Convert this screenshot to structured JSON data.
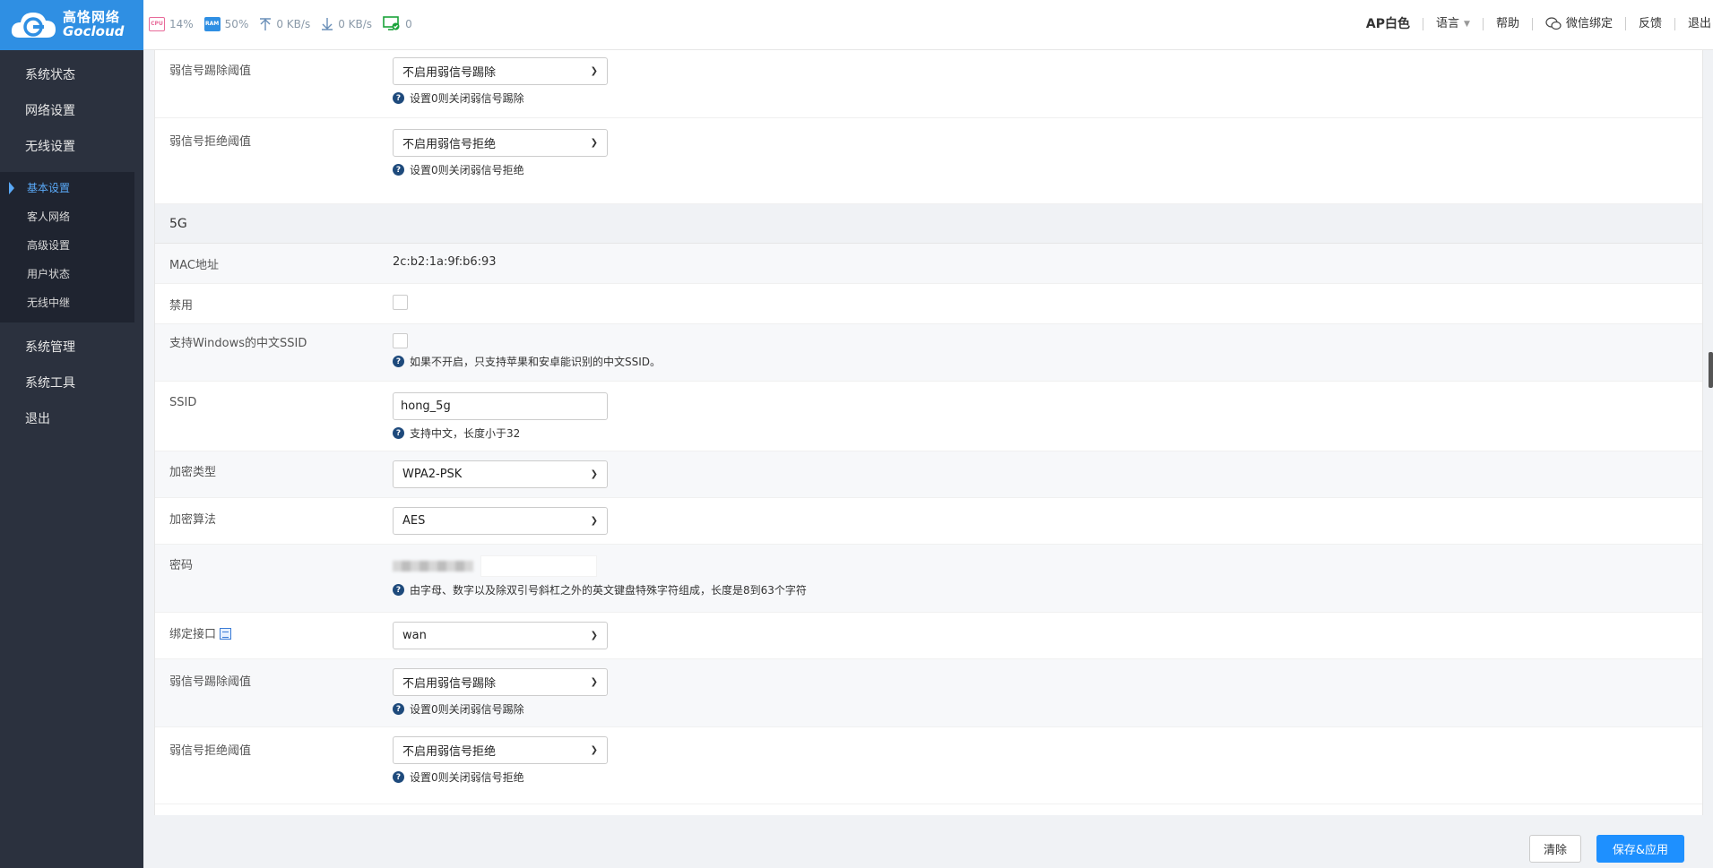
{
  "brand": {
    "cn": "高恪网络",
    "en": "Gocloud"
  },
  "stats": {
    "cpu_label": "CPU",
    "cpu": "14%",
    "ram_label": "RAM",
    "ram": "50%",
    "upload": "0 KB/s",
    "download": "0 KB/s",
    "devices": "0"
  },
  "topnav": {
    "ap": "AP白色",
    "language": "语言",
    "help": "帮助",
    "wechat": "微信绑定",
    "feedback": "反馈",
    "logout": "退出"
  },
  "sidebar": {
    "items": [
      "系统状态",
      "网络设置",
      "无线设置"
    ],
    "sub_items": [
      "基本设置",
      "客人网络",
      "高级设置",
      "用户状态",
      "无线中继"
    ],
    "items_after": [
      "系统管理",
      "系统工具",
      "退出"
    ]
  },
  "form_top": {
    "kick_label": "弱信号踢除阈值",
    "kick_value": "不启用弱信号踢除",
    "kick_hint": "设置0则关闭弱信号踢除",
    "reject_label": "弱信号拒绝阈值",
    "reject_value": "不启用弱信号拒绝",
    "reject_hint": "设置0则关闭弱信号拒绝"
  },
  "section_5g": {
    "title": "5G",
    "mac_label": "MAC地址",
    "mac_value": "2c:b2:1a:9f:b6:93",
    "disable_label": "禁用",
    "win_ssid_label": "支持Windows的中文SSID",
    "win_ssid_hint": "如果不开启，只支持苹果和安卓能识别的中文SSID。",
    "ssid_label": "SSID",
    "ssid_value": "hong_5g",
    "ssid_hint": "支持中文，长度小于32",
    "enc_type_label": "加密类型",
    "enc_type_value": "WPA2-PSK",
    "enc_algo_label": "加密算法",
    "enc_algo_value": "AES",
    "password_label": "密码",
    "password_hint": "由字母、数字以及除双引号斜杠之外的英文键盘特殊字符组成，长度是8到63个字符",
    "bind_label": "绑定接口",
    "bind_value": "wan",
    "kick_label": "弱信号踢除阈值",
    "kick_value": "不启用弱信号踢除",
    "kick_hint": "设置0则关闭弱信号踢除",
    "reject_label": "弱信号拒绝阈值",
    "reject_value": "不启用弱信号拒绝",
    "reject_hint": "设置0则关闭弱信号拒绝"
  },
  "buttons": {
    "clear": "清除",
    "save": "保存&应用"
  }
}
